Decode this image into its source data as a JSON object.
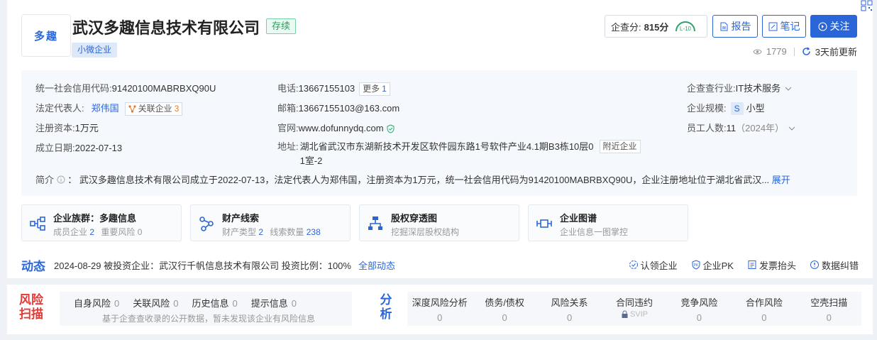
{
  "header": {
    "logo_text": "多趣",
    "company_name": "武汉多趣信息技术有限公司",
    "status": "存续",
    "size_tag": "小微企业",
    "score_label": "企查分:",
    "score_value": "815分",
    "score_badge": "L-10",
    "buttons": {
      "report": "报告",
      "notes": "笔记",
      "follow": "关注"
    },
    "views": "1779",
    "updated": "3天前更新"
  },
  "info": {
    "left": [
      {
        "label": "统一社会信用代码:",
        "value": "91420100MABRBXQ90U"
      },
      {
        "label": "法定代表人:",
        "value": "郑伟国",
        "tag_label": "关联企业",
        "tag_count": "3"
      },
      {
        "label": "注册资本:",
        "value": "1万元"
      },
      {
        "label": "成立日期:",
        "value": "2022-07-13"
      }
    ],
    "mid": {
      "phone_label": "电话:",
      "phone": "13667155103",
      "phone_more": "更多",
      "phone_more_count": "1",
      "email_label": "邮箱:",
      "email": "13667155103@163.com",
      "web_label": "官网:",
      "web": "www.dofunnydq.com",
      "addr_label": "地址:",
      "addr_line1": "湖北省武汉市东湖新技术开发区软件园东路1号软件产业4.1期B3栋10层0",
      "addr_line2": "1室-2",
      "addr_nearby": "附近企业"
    },
    "right": {
      "industry_label": "企查查行业:",
      "industry": "IT技术服务",
      "scale_label": "企业规模:",
      "scale_tag": "S",
      "scale": "小型",
      "staff_label": "员工人数:",
      "staff": "11",
      "staff_year": "（2024年）"
    },
    "intro_label": "简介",
    "intro_text": "武汉多趣信息技术有限公司成立于2022-07-13，法定代表人为郑伟国，注册资本为1万元，统一社会信用代码为91420100MABRBXQ90U，企业注册地址位于湖北省武汉...",
    "intro_expand": "展开"
  },
  "features": [
    {
      "title": "企业族群：多趣信息",
      "sub1": "成员企业",
      "n1": "2",
      "sub2": "重要风险",
      "n2": "0"
    },
    {
      "title": "财产线索",
      "sub1": "财产类型",
      "n1": "2",
      "sub2": "线索数量",
      "n2": "238"
    },
    {
      "title": "股权穿透图",
      "sub1": "挖掘深层股权结构",
      "n1": "",
      "sub2": "",
      "n2": ""
    },
    {
      "title": "企业图谱",
      "sub1": "企业信息一图掌控",
      "n1": "",
      "sub2": "",
      "n2": ""
    }
  ],
  "dynamic": {
    "title": "动态",
    "text": "2024-08-29 被投资企业：武汉行千帆信息技术有限公司 投资比例：100%",
    "link": "全部动态",
    "actions": [
      "认领企业",
      "企业PK",
      "发票抬头",
      "数据纠错"
    ]
  },
  "risk": {
    "title": "风险扫描",
    "items": [
      {
        "label": "自身风险",
        "count": "0"
      },
      {
        "label": "关联风险",
        "count": "0"
      },
      {
        "label": "历史信息",
        "count": "0"
      },
      {
        "label": "提示信息",
        "count": "0"
      }
    ],
    "note": "基于企查查收录的公开数据，暂未发现该企业有风险信息"
  },
  "analysis": {
    "title": "分析",
    "items": [
      {
        "label": "深度风险分析",
        "value": "0"
      },
      {
        "label": "债务/债权",
        "value": "0"
      },
      {
        "label": "风险关系",
        "value": "0"
      },
      {
        "label": "合同违约",
        "value": "SVIP"
      },
      {
        "label": "竞争风险",
        "value": "0"
      },
      {
        "label": "合作风险",
        "value": "0"
      },
      {
        "label": "空壳扫描",
        "value": "0"
      }
    ]
  }
}
